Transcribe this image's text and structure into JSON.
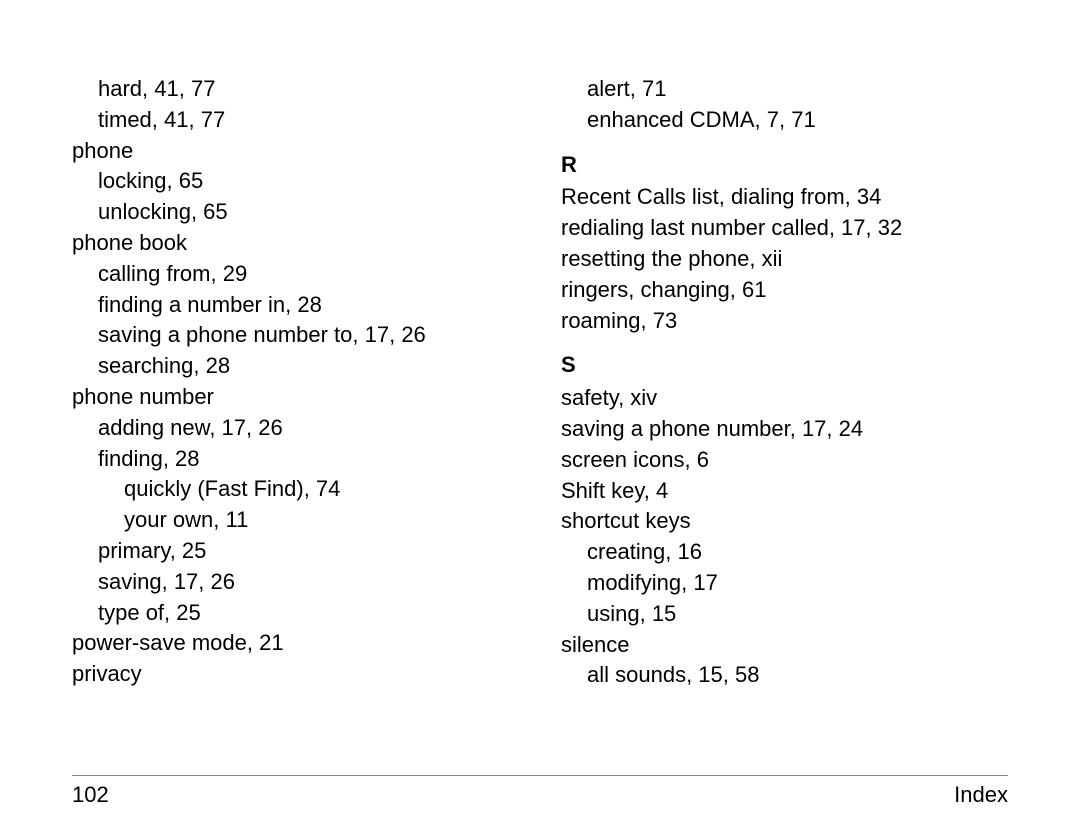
{
  "footer": {
    "page_number": "102",
    "title": "Index"
  },
  "left_column": [
    {
      "indent": 1,
      "text": "hard, 41, 77"
    },
    {
      "indent": 1,
      "text": "timed, 41, 77"
    },
    {
      "indent": 0,
      "text": "phone"
    },
    {
      "indent": 1,
      "text": "locking, 65"
    },
    {
      "indent": 1,
      "text": "unlocking, 65"
    },
    {
      "indent": 0,
      "text": "phone book"
    },
    {
      "indent": 1,
      "text": "calling from, 29"
    },
    {
      "indent": 1,
      "text": "finding a number in, 28"
    },
    {
      "indent": 1,
      "text": "saving a phone number to, 17, 26"
    },
    {
      "indent": 1,
      "text": "searching, 28"
    },
    {
      "indent": 0,
      "text": "phone number"
    },
    {
      "indent": 1,
      "text": "adding new, 17, 26"
    },
    {
      "indent": 1,
      "text": "finding, 28"
    },
    {
      "indent": 2,
      "text": "quickly (Fast Find), 74"
    },
    {
      "indent": 2,
      "text": "your own, 11"
    },
    {
      "indent": 1,
      "text": "primary, 25"
    },
    {
      "indent": 1,
      "text": "saving, 17, 26"
    },
    {
      "indent": 1,
      "text": "type of, 25"
    },
    {
      "indent": 0,
      "text": "power-save mode, 21"
    },
    {
      "indent": 0,
      "text": "privacy"
    }
  ],
  "right_column": [
    {
      "indent": 1,
      "text": "alert, 71"
    },
    {
      "indent": 1,
      "text": "enhanced CDMA, 7, 71"
    },
    {
      "section": true,
      "text": "R"
    },
    {
      "indent": 0,
      "text": "Recent Calls list, dialing from, 34"
    },
    {
      "indent": 0,
      "text": "redialing last number called, 17, 32"
    },
    {
      "indent": 0,
      "text": "resetting the phone, xii"
    },
    {
      "indent": 0,
      "text": "ringers, changing, 61"
    },
    {
      "indent": 0,
      "text": "roaming, 73"
    },
    {
      "section": true,
      "text": "S"
    },
    {
      "indent": 0,
      "text": "safety, xiv"
    },
    {
      "indent": 0,
      "text": "saving a phone number, 17, 24"
    },
    {
      "indent": 0,
      "text": "screen icons, 6"
    },
    {
      "indent": 0,
      "text": "Shift key, 4"
    },
    {
      "indent": 0,
      "text": "shortcut keys"
    },
    {
      "indent": 1,
      "text": "creating, 16"
    },
    {
      "indent": 1,
      "text": "modifying, 17"
    },
    {
      "indent": 1,
      "text": "using, 15"
    },
    {
      "indent": 0,
      "text": "silence"
    },
    {
      "indent": 1,
      "text": "all sounds, 15, 58"
    }
  ]
}
